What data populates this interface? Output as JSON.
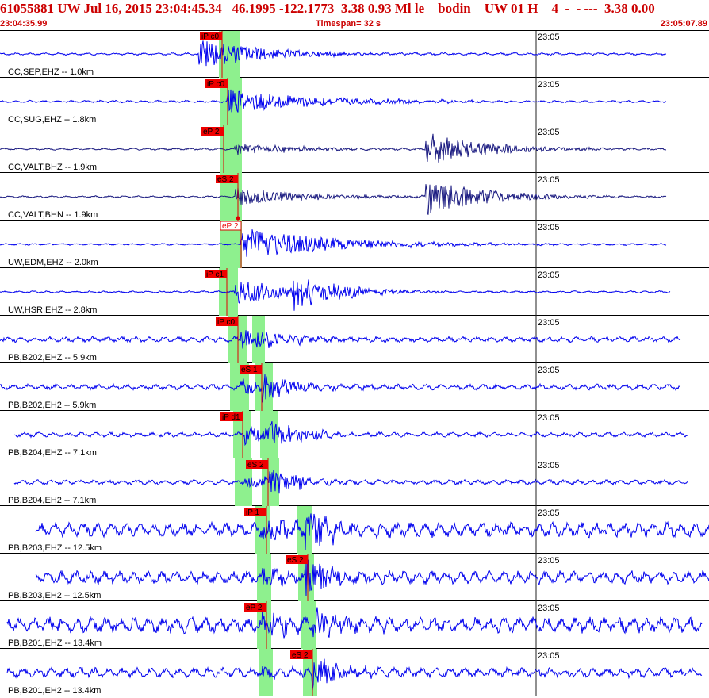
{
  "header": {
    "title": "61055881 UW Jul 16, 2015 23:04:45.34   46.1995 -122.1773  3.38 0.93 Ml le    bodin    UW 01 H    4  -  - ---  3.38 0.00",
    "start_time": "23:04:35.99",
    "timespan": "Timespan=  32 s",
    "end_time": "23:05:07.89"
  },
  "colors": {
    "header_text": "#cc0000",
    "trace_blue": "#0000ee",
    "trace_navy": "#1a1a80",
    "pick_window": "#8ef08e",
    "pick_box": "#ee0000",
    "pick_line": "#dd0000"
  },
  "time_label": "23:05",
  "traces": [
    {
      "label": "CC,SEP,EHZ -- 1.0km",
      "color": "blue",
      "picks": [
        {
          "text": "iP c0",
          "kind": "P"
        }
      ],
      "wave": {
        "noise": 1.5,
        "onset": 0.28,
        "ampP": 20,
        "decayP": 0.09,
        "sOnset": null,
        "ampS": 0,
        "decayS": 0.1,
        "span": [
          0,
          0.94
        ]
      }
    },
    {
      "label": "CC,SUG,EHZ -- 1.8km",
      "color": "blue",
      "picks": [
        {
          "text": "iP c0",
          "kind": "P"
        }
      ],
      "wave": {
        "noise": 1.5,
        "onset": 0.32,
        "ampP": 16,
        "decayP": 0.12,
        "sOnset": null,
        "ampS": 0,
        "decayS": 0.1,
        "span": [
          0,
          0.94
        ]
      }
    },
    {
      "label": "CC,VALT,BHZ -- 1.9km",
      "color": "navy",
      "picks": [
        {
          "text": "eP 2",
          "kind": "P"
        }
      ],
      "wave": {
        "noise": 1.2,
        "onset": 0.33,
        "ampP": 7,
        "decayP": 0.1,
        "sOnset": 0.6,
        "ampS": 22,
        "decayS": 0.08,
        "span": [
          0,
          0.94
        ]
      }
    },
    {
      "label": "CC,VALT,BHN -- 1.9km",
      "color": "navy",
      "picks": [
        {
          "text": "eS 2",
          "kind": "S"
        }
      ],
      "wave": {
        "noise": 1.2,
        "onset": 0.33,
        "ampP": 12,
        "decayP": 0.1,
        "sOnset": 0.6,
        "ampS": 24,
        "decayS": 0.08,
        "span": [
          0,
          0.94
        ]
      }
    },
    {
      "label": "UW,EDM,EHZ -- 2.0km",
      "color": "blue",
      "picks": [
        {
          "text": "eP 2",
          "kind": "P2"
        }
      ],
      "wave": {
        "noise": 1.2,
        "onset": 0.34,
        "ampP": 22,
        "decayP": 0.12,
        "sOnset": null,
        "ampS": 0,
        "decayS": 0.1,
        "span": [
          0,
          0.94
        ]
      }
    },
    {
      "label": "UW,HSR,EHZ -- 2.8km",
      "color": "blue",
      "picks": [
        {
          "text": "iP c1",
          "kind": "P"
        }
      ],
      "wave": {
        "noise": 1.3,
        "onset": 0.33,
        "ampP": 18,
        "decayP": 0.08,
        "sOnset": 0.41,
        "ampS": 24,
        "decayS": 0.06,
        "span": [
          0,
          0.945
        ]
      }
    },
    {
      "label": "PB,B202,EHZ -- 5.9km",
      "color": "blue",
      "picks": [
        {
          "text": "iP c0",
          "kind": "P"
        }
      ],
      "wave": {
        "noise": 3.5,
        "onset": 0.34,
        "ampP": 18,
        "decayP": 0.05,
        "sOnset": 0.36,
        "ampS": 10,
        "decayS": 0.05,
        "span": [
          0,
          0.96
        ]
      }
    },
    {
      "label": "PB,B202,EH2 -- 5.9km",
      "color": "blue",
      "picks": [
        {
          "text": "eS 1",
          "kind": "S"
        }
      ],
      "wave": {
        "noise": 3.5,
        "onset": 0.34,
        "ampP": 10,
        "decayP": 0.05,
        "sOnset": 0.37,
        "ampS": 18,
        "decayS": 0.05,
        "span": [
          0,
          0.96
        ]
      }
    },
    {
      "label": "PB,B204,EHZ -- 7.1km",
      "color": "blue",
      "picks": [
        {
          "text": "iP d1",
          "kind": "P"
        }
      ],
      "wave": {
        "noise": 3,
        "onset": 0.345,
        "ampP": 12,
        "decayP": 0.05,
        "sOnset": 0.38,
        "ampS": 20,
        "decayS": 0.04,
        "span": [
          0.02,
          0.97
        ]
      }
    },
    {
      "label": "PB,B204,EH2 -- 7.1km",
      "color": "blue",
      "picks": [
        {
          "text": "eS 2",
          "kind": "S"
        }
      ],
      "wave": {
        "noise": 3,
        "onset": 0.345,
        "ampP": 8,
        "decayP": 0.05,
        "sOnset": 0.38,
        "ampS": 20,
        "decayS": 0.04,
        "span": [
          0.02,
          0.97
        ]
      }
    },
    {
      "label": "PB,B203,EHZ -- 12.5km",
      "color": "blue",
      "picks": [
        {
          "text": "iP 1",
          "kind": "P"
        }
      ],
      "wave": {
        "noise": 9,
        "onset": 0.37,
        "ampP": 14,
        "decayP": 0.05,
        "sOnset": 0.43,
        "ampS": 26,
        "decayS": 0.04,
        "span": [
          0.05,
          1
        ]
      }
    },
    {
      "label": "PB,B203,EH2 -- 12.5km",
      "color": "blue",
      "picks": [
        {
          "text": "eS 2",
          "kind": "S"
        }
      ],
      "wave": {
        "noise": 8,
        "onset": 0.37,
        "ampP": 10,
        "decayP": 0.05,
        "sOnset": 0.43,
        "ampS": 26,
        "decayS": 0.04,
        "span": [
          0.05,
          1
        ]
      }
    },
    {
      "label": "PB,B201,EHZ -- 13.4km",
      "color": "blue",
      "picks": [
        {
          "text": "eP 2",
          "kind": "P"
        }
      ],
      "wave": {
        "noise": 10,
        "onset": 0.37,
        "ampP": 14,
        "decayP": 0.05,
        "sOnset": 0.44,
        "ampS": 24,
        "decayS": 0.04,
        "span": [
          0.01,
          0.99
        ]
      }
    },
    {
      "label": "PB,B201,EH2 -- 13.4km",
      "color": "blue",
      "picks": [
        {
          "text": "eS 2",
          "kind": "S"
        }
      ],
      "wave": {
        "noise": 6,
        "onset": 0.37,
        "ampP": 8,
        "decayP": 0.05,
        "sOnset": 0.44,
        "ampS": 20,
        "decayS": 0.04,
        "span": [
          0.01,
          0.99
        ]
      }
    }
  ]
}
